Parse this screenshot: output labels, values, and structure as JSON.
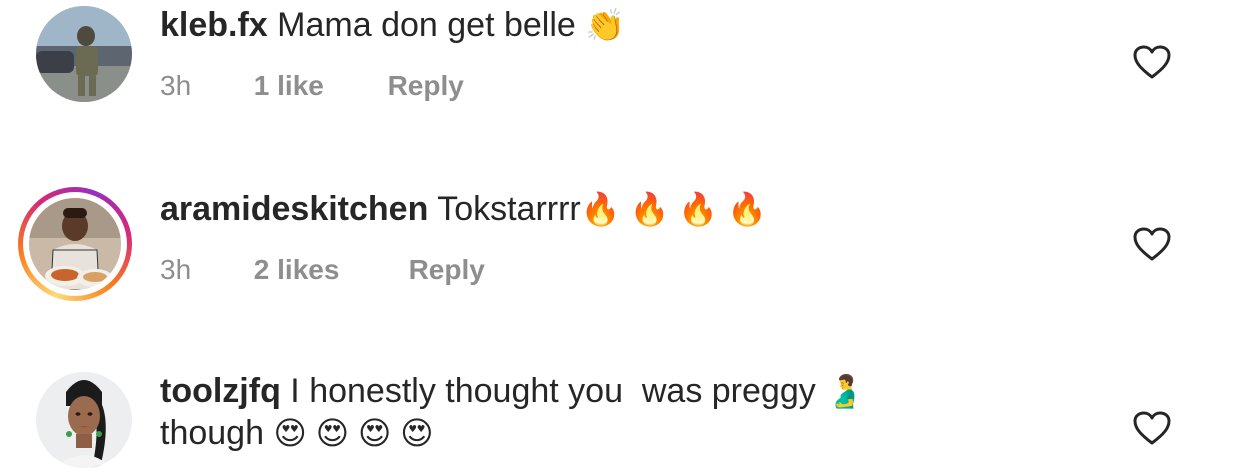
{
  "comments": [
    {
      "username": "kleb.fx",
      "text": "Mama don get belle",
      "emoji": "👏",
      "time": "3h",
      "likes": "1 like",
      "reply": "Reply",
      "has_story_ring": false
    },
    {
      "username": "aramideskitchen",
      "text": "Tokstarrrr",
      "emoji": "🔥 🔥 🔥 🔥",
      "time": "3h",
      "likes": "2 likes",
      "reply": "Reply",
      "has_story_ring": true
    },
    {
      "username": "toolzjfq",
      "text": "I honestly thought you  was preggy",
      "emoji": "🫃",
      "text_line2": "though",
      "emoji_line2": "😍 😍 😍 😍",
      "has_story_ring": false
    }
  ],
  "colors": {
    "text": "#262626",
    "meta": "#8e8e8e",
    "heart_stroke": "#262626"
  },
  "icons": {
    "like": "heart-outline-icon"
  }
}
